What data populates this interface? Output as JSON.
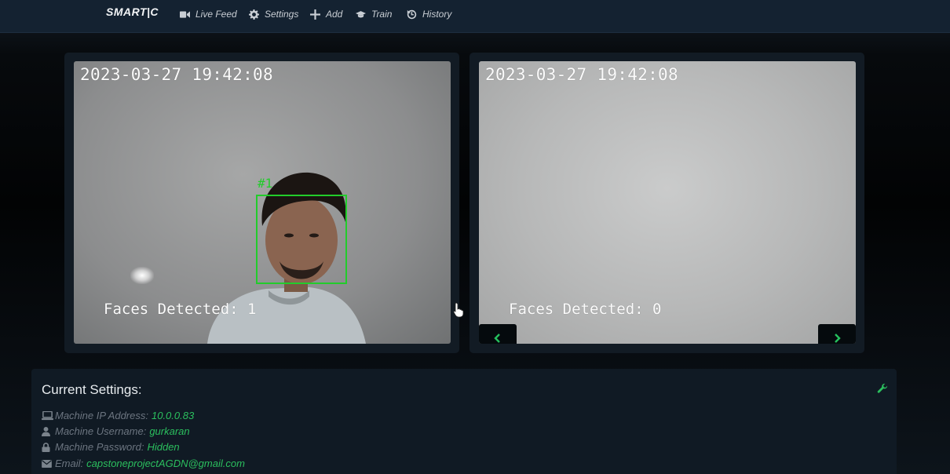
{
  "navbar": {
    "brand": "SMART|C",
    "items": [
      {
        "label": "Live Feed",
        "icon": "video-camera-icon"
      },
      {
        "label": "Settings",
        "icon": "gear-icon"
      },
      {
        "label": "Add",
        "icon": "plus-icon"
      },
      {
        "label": "Train",
        "icon": "graduation-cap-icon"
      },
      {
        "label": "History",
        "icon": "history-icon"
      }
    ]
  },
  "feeds": [
    {
      "timestamp": "2023-03-27 19:42:08",
      "faces_text": "Faces Detected: 1",
      "face_label": "#1"
    },
    {
      "timestamp": "2023-03-27 19:42:08",
      "faces_text": "Faces Detected: 0"
    }
  ],
  "settings": {
    "title": "Current Settings:",
    "rows": [
      {
        "label": "Machine IP Address:",
        "value": "10.0.0.83",
        "icon": "laptop-icon"
      },
      {
        "label": "Machine Username:",
        "value": "gurkaran",
        "icon": "user-icon"
      },
      {
        "label": "Machine Password:",
        "value": "Hidden",
        "icon": "lock-icon"
      },
      {
        "label": "Email:",
        "value": "capstoneprojectAGDN@gmail.com",
        "icon": "envelope-icon"
      }
    ]
  },
  "colors": {
    "accent": "#2bbf5e",
    "navbar_bg": "#142231",
    "panel_bg": "#101a24",
    "detection_box": "#22cc2b"
  }
}
